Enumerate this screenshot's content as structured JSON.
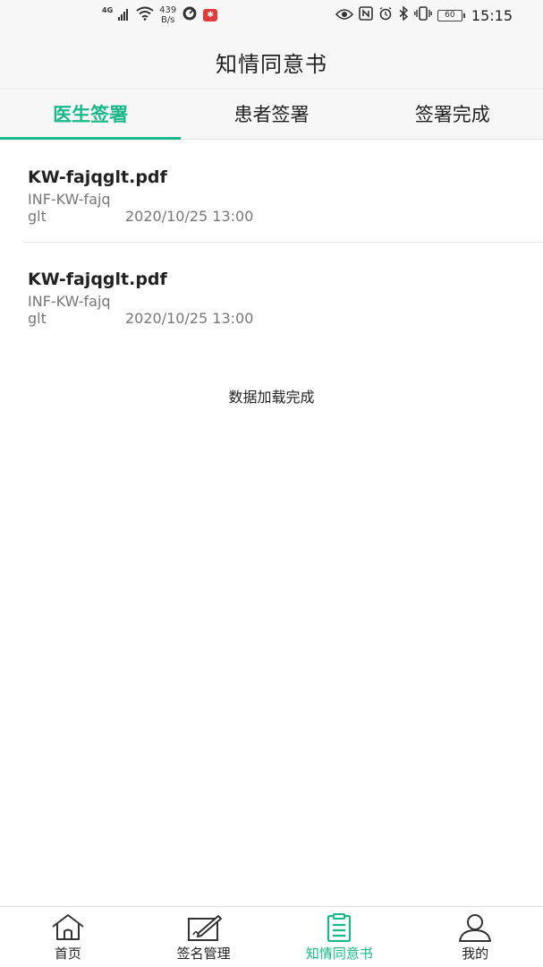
{
  "status_bar": {
    "network": "4G",
    "speed_value": "439",
    "speed_unit": "B/s",
    "battery": "60",
    "time": "15:15"
  },
  "header": {
    "title": "知情同意书"
  },
  "tabs": [
    {
      "label": "医生签署",
      "active": true
    },
    {
      "label": "患者签署",
      "active": false
    },
    {
      "label": "签署完成",
      "active": false
    }
  ],
  "documents": [
    {
      "filename": "KW-fajqglt.pdf",
      "code": "INF-KW-fajq",
      "user": "glt",
      "datetime": "2020/10/25 13:00"
    },
    {
      "filename": "KW-fajqglt.pdf",
      "code": "INF-KW-fajq",
      "user": "glt",
      "datetime": "2020/10/25 13:00"
    }
  ],
  "load_status": "数据加载完成",
  "bottom_nav": [
    {
      "label": "首页",
      "icon": "home-icon",
      "active": false
    },
    {
      "label": "签名管理",
      "icon": "signature-pen-icon",
      "active": false
    },
    {
      "label": "知情同意书",
      "icon": "clipboard-document-icon",
      "active": true
    },
    {
      "label": "我的",
      "icon": "user-profile-icon",
      "active": false
    }
  ],
  "colors": {
    "accent": "#19b88a",
    "header_bg": "#f7f7f7",
    "text_primary": "#222222",
    "text_secondary": "#777777"
  }
}
